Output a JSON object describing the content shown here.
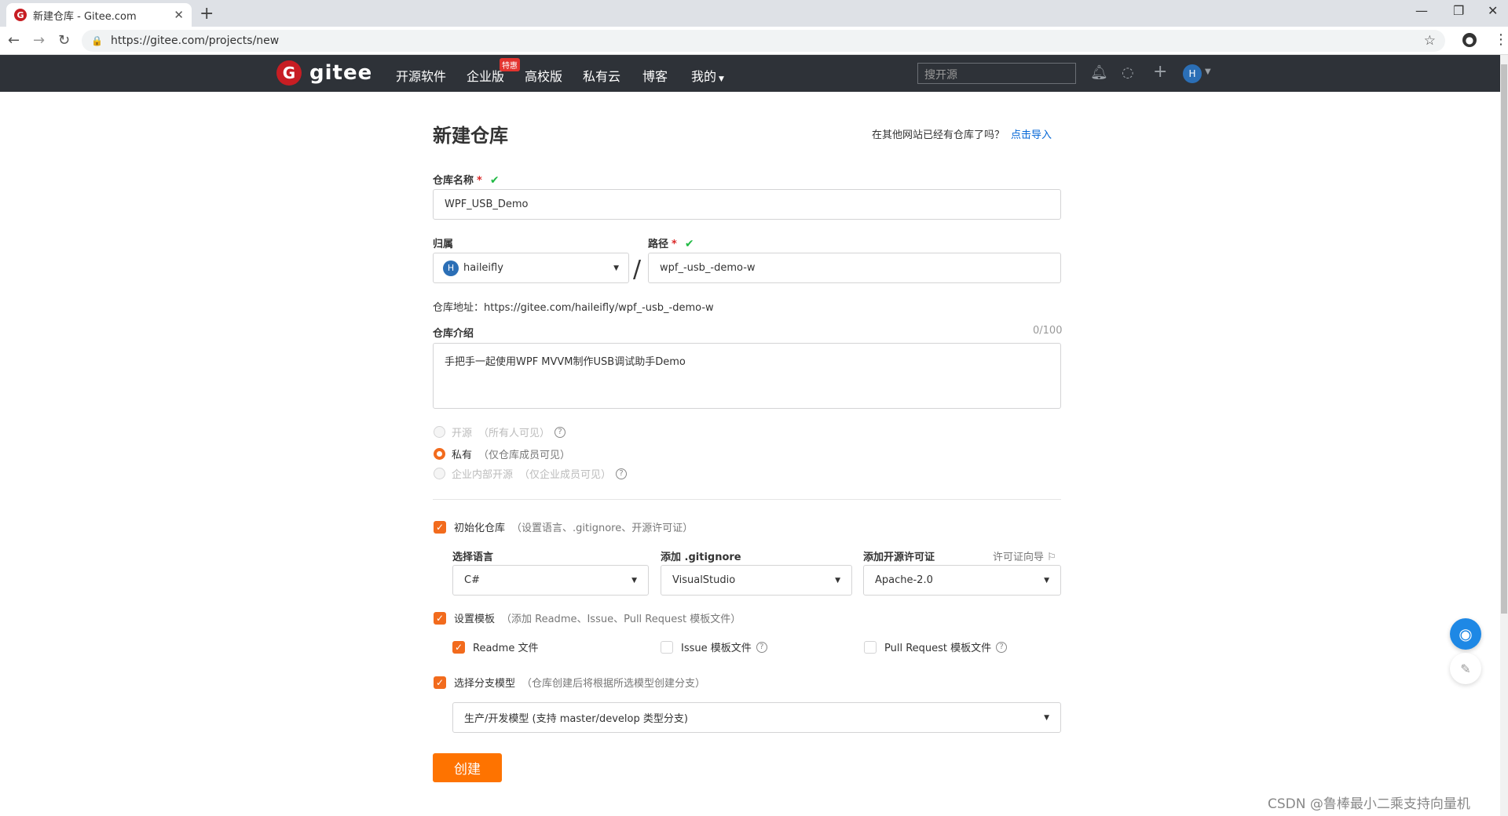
{
  "browser": {
    "tab_title": "新建仓库 - Gitee.com",
    "tab_close": "✕",
    "new_tab": "+",
    "favicon": "G",
    "url": "https://gitee.com/projects/new",
    "profile_initial": "●"
  },
  "header": {
    "logo_letter": "G",
    "logo_text": "gitee",
    "nav": [
      "开源软件",
      "企业版",
      "高校版",
      "私有云",
      "博客",
      "我的"
    ],
    "badge": "特惠",
    "search_placeholder": "搜开源",
    "avatar_initial": "H"
  },
  "form": {
    "title": "新建仓库",
    "import_text": "在其他网站已经有仓库了吗？",
    "import_link": "点击导入",
    "name_label": "仓库名称",
    "required_mark": "*",
    "check_mark": "✔",
    "name_value": "WPF_USB_Demo",
    "owner_label": "归属",
    "owner_initial": "H",
    "owner_value": "haileifly",
    "separator": "/",
    "path_label": "路径",
    "path_value": "wpf_-usb_-demo-w",
    "repo_url_text": "仓库地址：https://gitee.com/haileifly/wpf_-usb_-demo-w",
    "desc_label": "仓库介绍",
    "desc_counter": "0/100",
    "desc_value": "手把手一起使用WPF MVVM制作USB调试助手Demo",
    "visibility": [
      {
        "label": "开源",
        "sub": "（所有人可见）",
        "selected": false,
        "disabled": true,
        "help": true
      },
      {
        "label": "私有",
        "sub": "（仅仓库成员可见）",
        "selected": true,
        "disabled": false,
        "help": false
      },
      {
        "label": "企业内部开源",
        "sub": "（仅企业成员可见）",
        "selected": false,
        "disabled": true,
        "help": true
      }
    ],
    "init_label": "初始化仓库",
    "init_sub": "（设置语言、.gitignore、开源许可证）",
    "lang_label": "选择语言",
    "lang_value": "C#",
    "gitignore_label": "添加 .gitignore",
    "gitignore_value": "VisualStudio",
    "license_label": "添加开源许可证",
    "license_guide": "许可证向导 ⚐",
    "license_value": "Apache-2.0",
    "template_label": "设置模板",
    "template_sub": "（添加 Readme、Issue、Pull Request 模板文件）",
    "readme_label": "Readme 文件",
    "issue_label": "Issue 模板文件",
    "pr_label": "Pull Request 模板文件",
    "branch_label": "选择分支模型",
    "branch_sub": "（仓库创建后将根据所选模型创建分支）",
    "branch_value": "生产/开发模型 (支持 master/develop 类型分支)",
    "create_button": "创建"
  },
  "watermark": "CSDN @鲁棒最小二乘支持向量机",
  "colors": {
    "accent": "#fe7300",
    "header_bg": "#2e3238",
    "link": "#0366d6",
    "success": "#21ba45"
  }
}
